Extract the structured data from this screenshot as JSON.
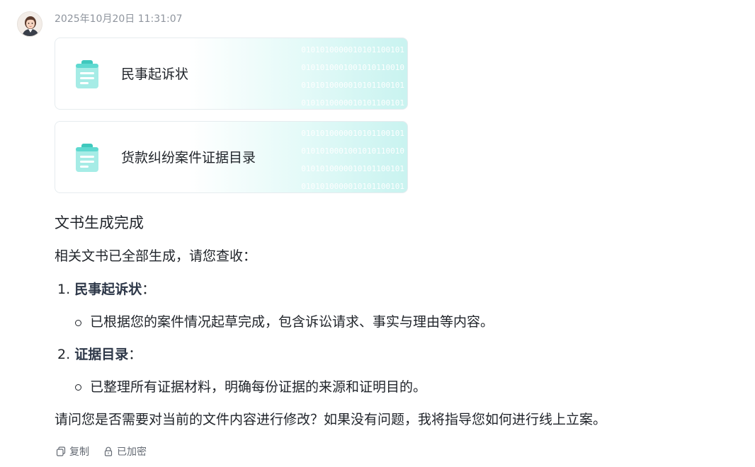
{
  "message": {
    "timestamp": "2025年10月20日 11:31:07"
  },
  "documents": [
    {
      "name": "民事起诉状",
      "binary": [
        "0101010000010101100101",
        "0101010001001010110010",
        "0101010000010101100101",
        "0101010000010101100101"
      ]
    },
    {
      "name": "货款纠纷案件证据目录",
      "binary": [
        "0101010000010101100101",
        "0101010001001010110010",
        "0101010000010101100101",
        "0101010000010101100101"
      ]
    }
  ],
  "content": {
    "heading": "文书生成完成",
    "intro": "相关文书已全部生成，请您查收：",
    "items": [
      {
        "num": "1.",
        "title": "民事起诉状",
        "colon": "：",
        "detail": "已根据您的案件情况起草完成，包含诉讼请求、事实与理由等内容。"
      },
      {
        "num": "2.",
        "title": "证据目录",
        "colon": "：",
        "detail": "已整理所有证据材料，明确每份证据的来源和证明目的。"
      }
    ],
    "closing": "请问您是否需要对当前的文件内容进行修改？如果没有问题，我将指导您如何进行线上立案。"
  },
  "actions": {
    "copy_label": "复制",
    "encrypted_label": "已加密"
  },
  "colors": {
    "icon_teal": "#5fd9d0",
    "card_gradient_end": "#c9f3f0",
    "timestamp_gray": "#8f959e"
  }
}
